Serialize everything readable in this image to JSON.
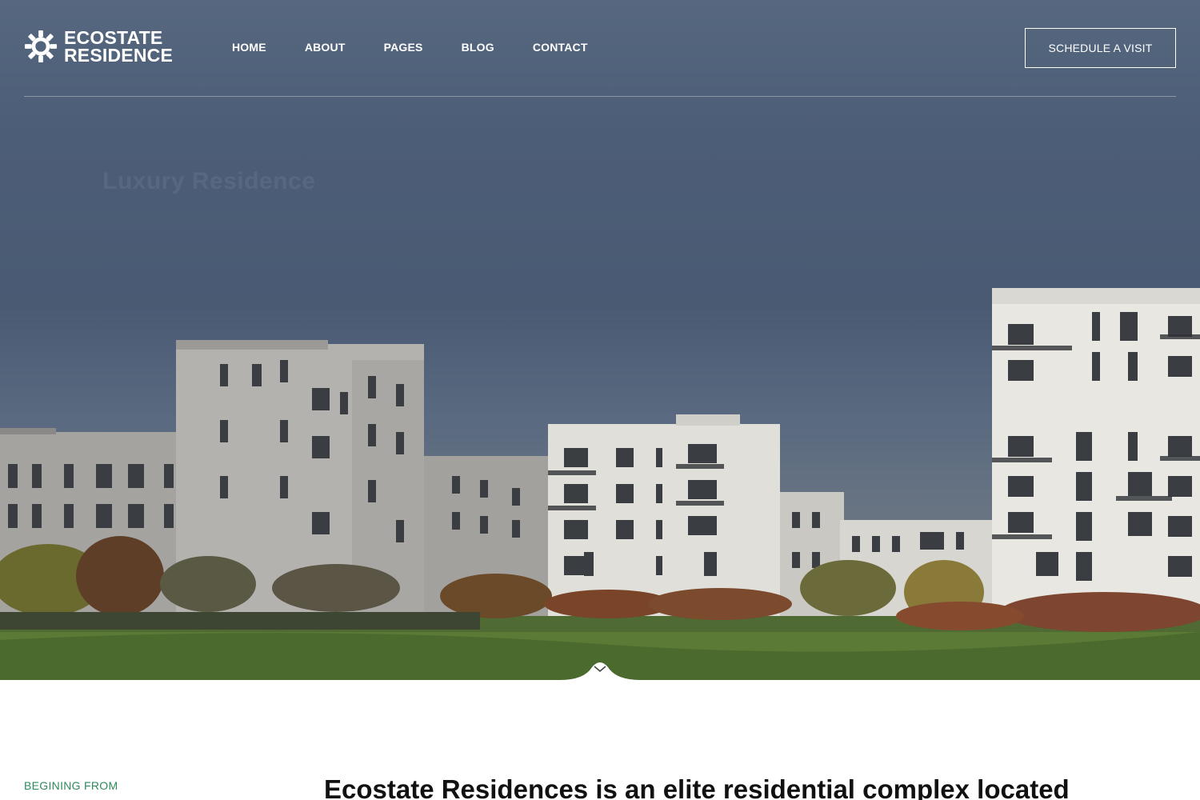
{
  "brand": {
    "line1": "ECOSTATE",
    "line2": "RESIDENCE",
    "logo_icon": "sunburst-gear-icon"
  },
  "nav": {
    "items": [
      {
        "label": "HOME"
      },
      {
        "label": "ABOUT"
      },
      {
        "label": "PAGES"
      },
      {
        "label": "BLOG"
      },
      {
        "label": "CONTACT"
      }
    ]
  },
  "header": {
    "cta_label": "SCHEDULE A VISIT"
  },
  "hero": {
    "faded_title": "Luxury Residence",
    "scroll_icon": "chevron-down-icon"
  },
  "content": {
    "eyebrow": "BEGINING FROM",
    "intro": "Ecostate Residences is an elite residential complex located"
  },
  "colors": {
    "accent_green": "#2e8a5c",
    "hero_sky": "#4a5a73",
    "white": "#ffffff"
  }
}
